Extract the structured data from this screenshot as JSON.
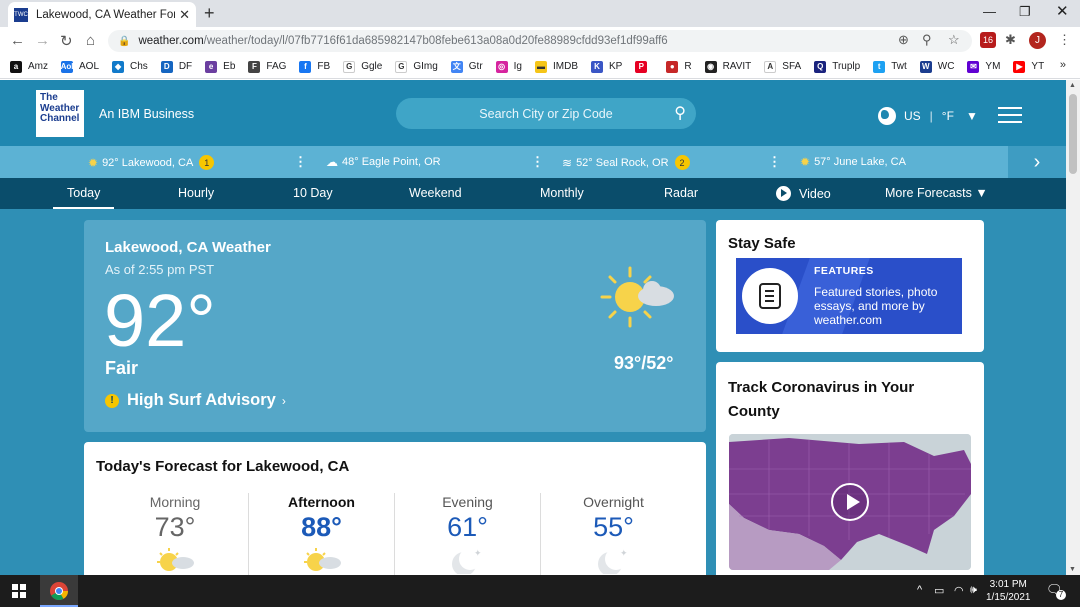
{
  "browser": {
    "tab_title": "Lakewood, CA Weather Forecast",
    "url_domain": "weather.com",
    "url_path": "/weather/today/l/07fb7716f61da685982147b08febe613a08a0d20fe88989cfdd93ef1df99aff6",
    "avatar_letter": "J",
    "ext_badge": "16",
    "bookmarks": [
      {
        "label": "Amz",
        "icon": "amazon-icon",
        "color": "#111111",
        "glyph": "a"
      },
      {
        "label": "AOL",
        "icon": "aol-icon",
        "color": "#1a73e8",
        "glyph": "Aol"
      },
      {
        "label": "Chs",
        "icon": "chase-icon",
        "color": "#117aca",
        "glyph": "◆"
      },
      {
        "label": "DF",
        "icon": "discover-icon",
        "color": "#1565c0",
        "glyph": "D"
      },
      {
        "label": "Eb",
        "icon": "ebay-icon",
        "color": "#6b3fa0",
        "glyph": "e"
      },
      {
        "label": "FAG",
        "icon": "fag-icon",
        "color": "#444444",
        "glyph": "F"
      },
      {
        "label": "FB",
        "icon": "facebook-icon",
        "color": "#1877f2",
        "glyph": "f"
      },
      {
        "label": "Ggle",
        "icon": "google-icon",
        "color": "#ffffff",
        "glyph": "G"
      },
      {
        "label": "GImg",
        "icon": "google-images-icon",
        "color": "#ffffff",
        "glyph": "G"
      },
      {
        "label": "Gtr",
        "icon": "google-translate-icon",
        "color": "#4285f4",
        "glyph": "文"
      },
      {
        "label": "Ig",
        "icon": "instagram-icon",
        "color": "#d6249f",
        "glyph": "◎"
      },
      {
        "label": "IMDB",
        "icon": "imdb-icon",
        "color": "#f5c518",
        "glyph": "▬"
      },
      {
        "label": "KP",
        "icon": "kp-icon",
        "color": "#3a56c5",
        "glyph": "K"
      },
      {
        "label": "",
        "icon": "pinterest-icon",
        "color": "#e60023",
        "glyph": "P"
      },
      {
        "label": "R",
        "icon": "r-icon",
        "color": "#c62828",
        "glyph": "●"
      },
      {
        "label": "RAVIT",
        "icon": "github-icon",
        "color": "#222222",
        "glyph": "◉"
      },
      {
        "label": "SFA",
        "icon": "sfa-icon",
        "color": "#ffffff",
        "glyph": "A"
      },
      {
        "label": "Truplp",
        "icon": "truplp-icon",
        "color": "#1a237e",
        "glyph": "Q"
      },
      {
        "label": "Twt",
        "icon": "twitter-icon",
        "color": "#1da1f2",
        "glyph": "t"
      },
      {
        "label": "WC",
        "icon": "weather-channel-icon",
        "color": "#1b3d8f",
        "glyph": "W"
      },
      {
        "label": "YM",
        "icon": "yahoo-mail-icon",
        "color": "#6001d2",
        "glyph": "✉"
      },
      {
        "label": "YT",
        "icon": "youtube-icon",
        "color": "#ff0000",
        "glyph": "▶"
      }
    ]
  },
  "site": {
    "logo_lines": [
      "The",
      "Weather",
      "Channel"
    ],
    "tagline": "An IBM Business",
    "search_placeholder": "Search City or Zip Code",
    "country": "US",
    "unit": "°F"
  },
  "recent_locations": [
    {
      "temp": "92°",
      "name": "Lakewood, CA",
      "badge": "1",
      "icon": "sun-icon"
    },
    {
      "temp": "48°",
      "name": "Eagle Point, OR",
      "badge": "",
      "icon": "cloud-icon"
    },
    {
      "temp": "52°",
      "name": "Seal Rock, OR",
      "badge": "2",
      "icon": "fog-icon"
    },
    {
      "temp": "57°",
      "name": "June Lake, CA",
      "badge": "",
      "icon": "sun-icon"
    }
  ],
  "nav_tabs": [
    "Today",
    "Hourly",
    "10 Day",
    "Weekend",
    "Monthly",
    "Radar",
    "Video",
    "More Forecasts"
  ],
  "current": {
    "title": "Lakewood, CA Weather",
    "as_of": "As of 2:55 pm PST",
    "temp": "92°",
    "phrase": "Fair",
    "hilo": "93°/52°",
    "alert": "High Surf Advisory"
  },
  "forecast": {
    "title": "Today's Forecast for Lakewood, CA",
    "periods": [
      {
        "label": "Morning",
        "temp": "73°",
        "icon": "partly-cloudy-sun-icon"
      },
      {
        "label": "Afternoon",
        "temp": "88°",
        "icon": "partly-cloudy-sun-icon"
      },
      {
        "label": "Evening",
        "temp": "61°",
        "icon": "moon-icon"
      },
      {
        "label": "Overnight",
        "temp": "55°",
        "icon": "moon-icon"
      }
    ]
  },
  "sidebar": {
    "stay_safe_title": "Stay Safe",
    "features_label": "FEATURES",
    "features_desc": "Featured stories, photo essays, and more by weather.com",
    "covid_title": "Track Coronavirus in Your County"
  },
  "taskbar": {
    "time": "3:01 PM",
    "date": "1/15/2021",
    "notif_count": "7"
  },
  "colors": {
    "brand": "#1f87b0",
    "nav": "#0a4d6b",
    "hero": "#55a7c8",
    "accent_blue": "#1c5ab8",
    "alert_yellow": "#f7c600"
  }
}
